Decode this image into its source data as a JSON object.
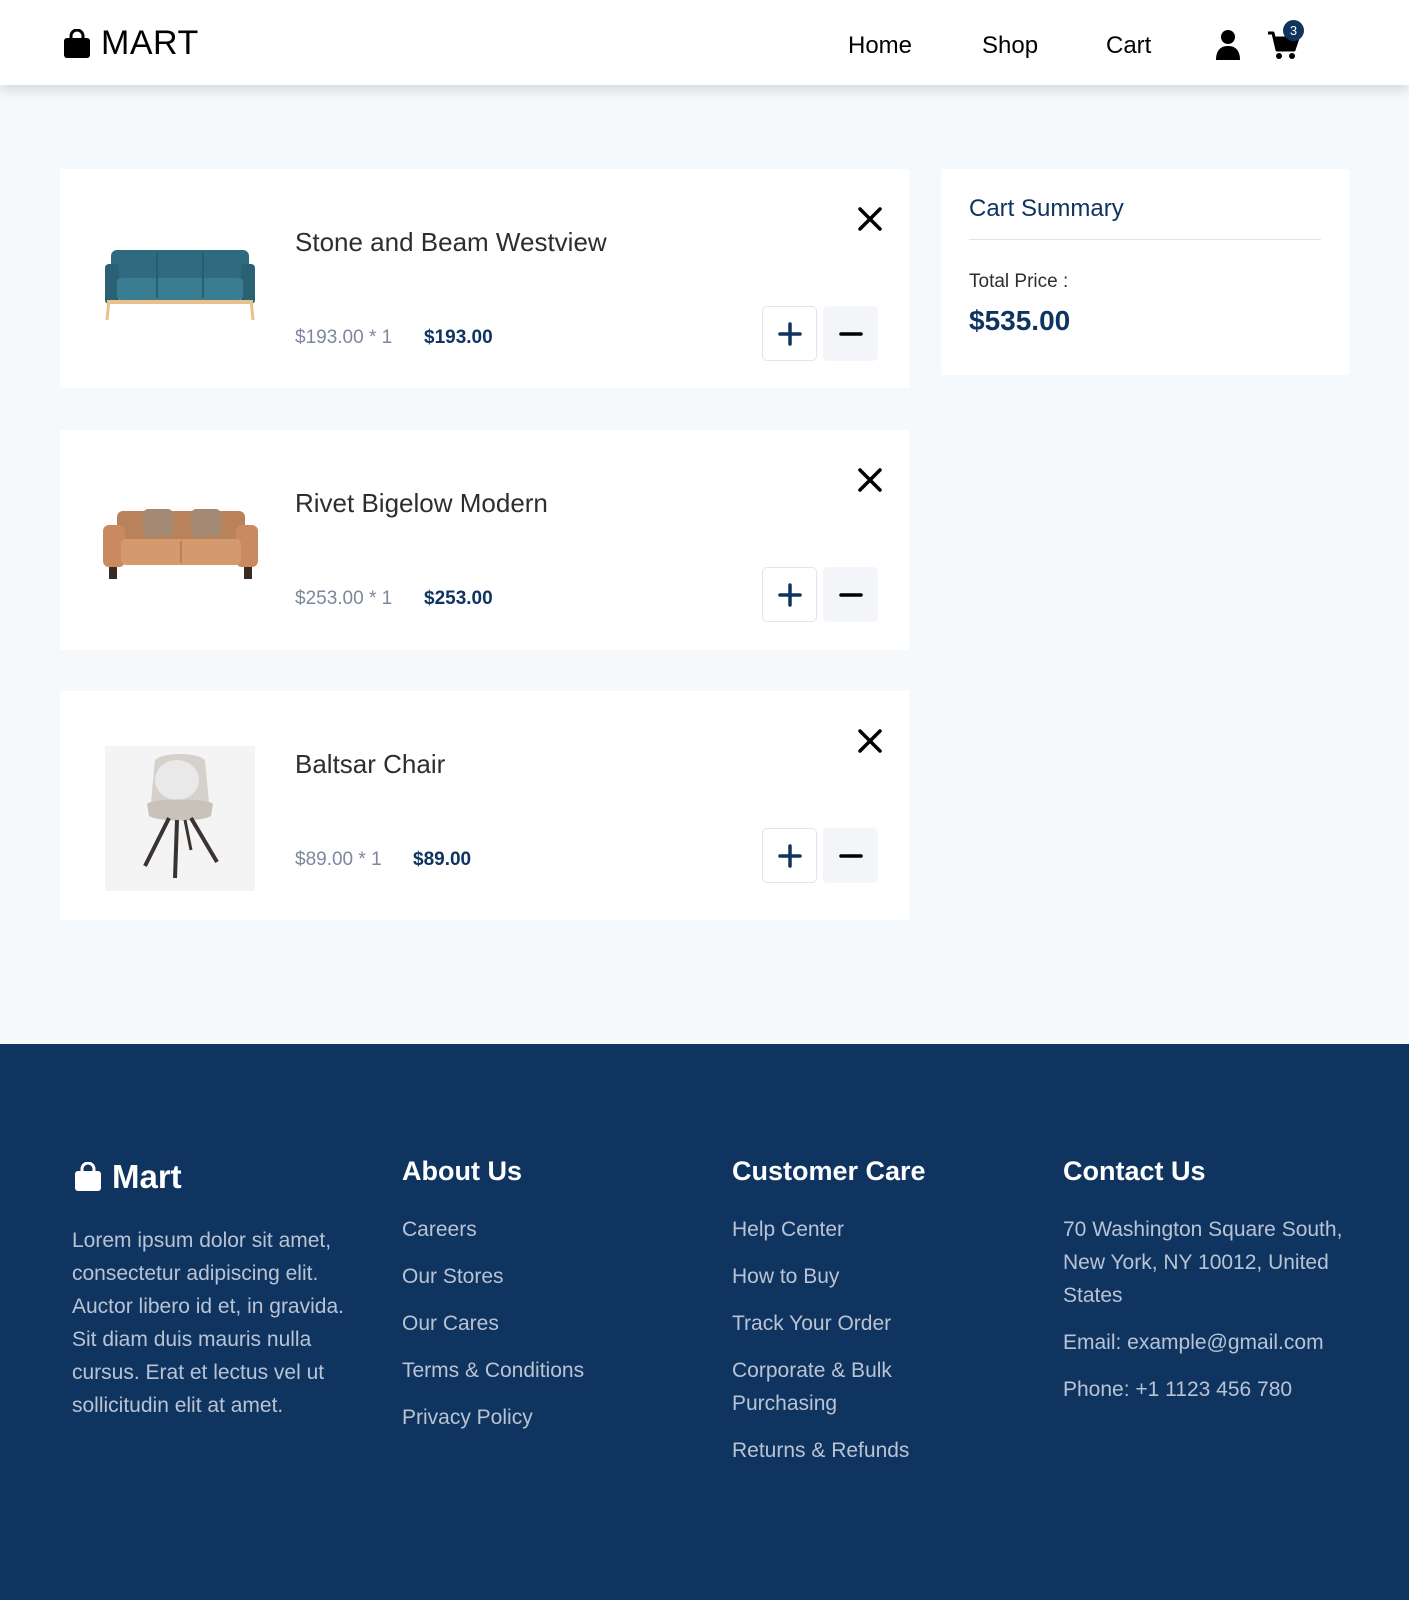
{
  "header": {
    "logo_text": "MART",
    "nav": [
      {
        "label": "Home"
      },
      {
        "label": "Shop"
      },
      {
        "label": "Cart"
      }
    ],
    "cart_count": "3"
  },
  "cart": {
    "items": [
      {
        "name": "Stone and Beam Westview",
        "unit_price": "$193.00 * 1",
        "total": "$193.00"
      },
      {
        "name": "Rivet Bigelow Modern",
        "unit_price": "$253.00 * 1",
        "total": "$253.00"
      },
      {
        "name": "Baltsar Chair",
        "unit_price": "$89.00 * 1",
        "total": "$89.00"
      }
    ]
  },
  "summary": {
    "title": "Cart Summary",
    "label": "Total Price :",
    "total": "$535.00"
  },
  "footer": {
    "logo_text": "Mart",
    "description": "Lorem ipsum dolor sit amet, consectetur adipiscing elit. Auctor libero id et, in gravida. Sit diam duis mauris nulla cursus. Erat et lectus vel ut sollicitudin elit at amet.",
    "about": {
      "heading": "About Us",
      "links": [
        "Careers",
        "Our Stores",
        "Our Cares",
        "Terms & Conditions",
        "Privacy Policy"
      ]
    },
    "care": {
      "heading": "Customer Care",
      "links": [
        "Help Center",
        "How to Buy",
        "Track Your Order",
        "Corporate & Bulk Purchasing",
        "Returns & Refunds"
      ]
    },
    "contact": {
      "heading": "Contact Us",
      "address": "70 Washington Square South, New York, NY 10012, United States",
      "email": "Email: example@gmail.com",
      "phone": "Phone: +1 1123 456 780"
    }
  }
}
